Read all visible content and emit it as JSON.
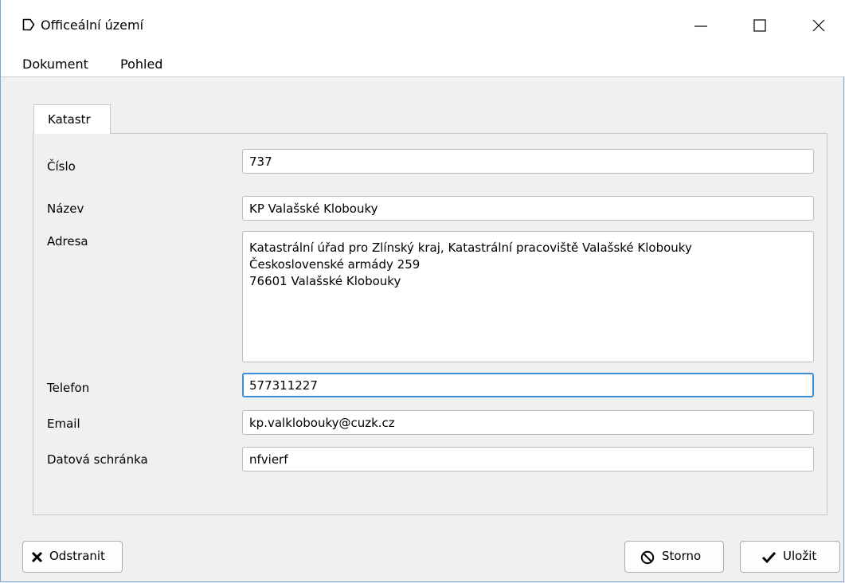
{
  "window": {
    "title": "Officeální území"
  },
  "menu": {
    "items": [
      "Dokument",
      "Pohled"
    ]
  },
  "tab": {
    "label": "Katastr"
  },
  "form": {
    "cislo": {
      "label": "Číslo",
      "value": "737"
    },
    "nazev": {
      "label": "Název",
      "value": "KP Valašské Klobouky"
    },
    "adresa": {
      "label": "Adresa",
      "value": "Katastrální úřad pro Zlínský kraj, Katastrální pracoviště Valašské Klobouky\nČeskoslovenské armády 259\n76601  Valašské Klobouky"
    },
    "telefon": {
      "label": "Telefon",
      "value": "577311227"
    },
    "email": {
      "label": "Email",
      "value": "kp.valklobouky@cuzk.cz"
    },
    "datova": {
      "label": "Datová schránka",
      "value": "nfvierf"
    }
  },
  "buttons": {
    "delete": "Odstranit",
    "cancel": "Storno",
    "save": "Uložit"
  },
  "icons": {
    "app": "document-icon",
    "minimize": "minimize-icon",
    "maximize": "maximize-icon",
    "close": "close-icon",
    "delete": "x-icon",
    "cancel": "no-entry-icon",
    "save": "checkmark-icon"
  },
  "colors": {
    "focus_border": "#3b8fd8",
    "window_border": "#7aa6d6"
  }
}
